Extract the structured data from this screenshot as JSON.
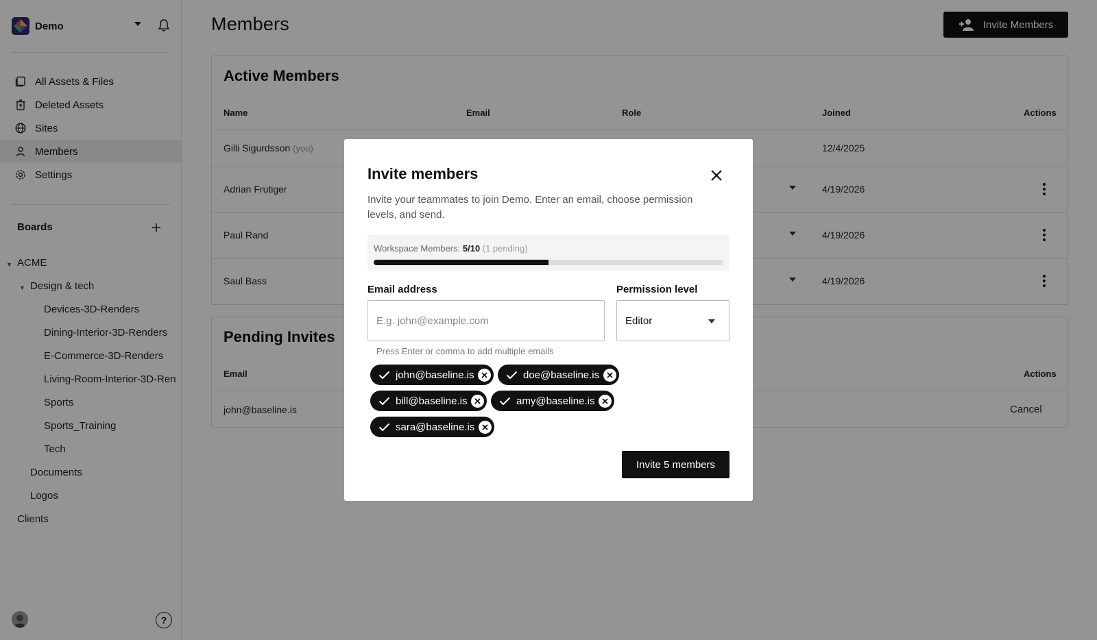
{
  "workspace": {
    "name": "Demo"
  },
  "nav": [
    {
      "label": "All Assets & Files",
      "icon": "files-icon"
    },
    {
      "label": "Deleted Assets",
      "icon": "trash-icon"
    },
    {
      "label": "Sites",
      "icon": "globe-icon"
    },
    {
      "label": "Members",
      "icon": "person-icon",
      "active": true
    },
    {
      "label": "Settings",
      "icon": "gear-icon"
    }
  ],
  "boards": {
    "title": "Boards",
    "tree": [
      {
        "label": "ACME"
      },
      {
        "label": "Design & tech"
      },
      {
        "label": "Devices-3D-Renders"
      },
      {
        "label": "Dining-Interior-3D-Renders"
      },
      {
        "label": "E-Commerce-3D-Renders"
      },
      {
        "label": "Living-Room-Interior-3D-Ren"
      },
      {
        "label": "Sports"
      },
      {
        "label": "Sports_Training"
      },
      {
        "label": "Tech"
      },
      {
        "label": "Documents"
      },
      {
        "label": "Logos"
      },
      {
        "label": "Clients"
      }
    ]
  },
  "header": {
    "title": "Members",
    "invite_label": "Invite Members"
  },
  "active_members": {
    "title": "Active Members",
    "columns": {
      "name": "Name",
      "email": "Email",
      "role": "Role",
      "joined": "Joined",
      "actions": "Actions"
    },
    "rows": [
      {
        "name": "Gilli Sigurdsson",
        "you": "(you)",
        "joined": "12/4/2025"
      },
      {
        "name": "Adrian Frutiger",
        "joined": "4/19/2026"
      },
      {
        "name": "Paul Rand",
        "joined": "4/19/2026"
      },
      {
        "name": "Saul Bass",
        "joined": "4/19/2026"
      }
    ]
  },
  "pending_invites": {
    "title": "Pending Invites",
    "columns": {
      "email": "Email",
      "actions": "Actions"
    },
    "rows": [
      {
        "email": "john@baseline.is",
        "action": "Cancel"
      }
    ]
  },
  "modal": {
    "title": "Invite members",
    "description": "Invite your teammates to join Demo. Enter an email, choose permission levels, and send.",
    "usage": {
      "label": "Workspace Members:",
      "count": "5/10",
      "pending": "(1 pending)",
      "fill_fraction": 0.5
    },
    "email_label": "Email address",
    "email_placeholder": "E.g. john@example.com",
    "permission_label": "Permission level",
    "permission_value": "Editor",
    "hint": "Press Enter or comma to add multiple emails",
    "chips": [
      "john@baseline.is",
      "doe@baseline.is",
      "bill@baseline.is",
      "amy@baseline.is",
      "sara@baseline.is"
    ],
    "submit_label": "Invite 5 members"
  }
}
